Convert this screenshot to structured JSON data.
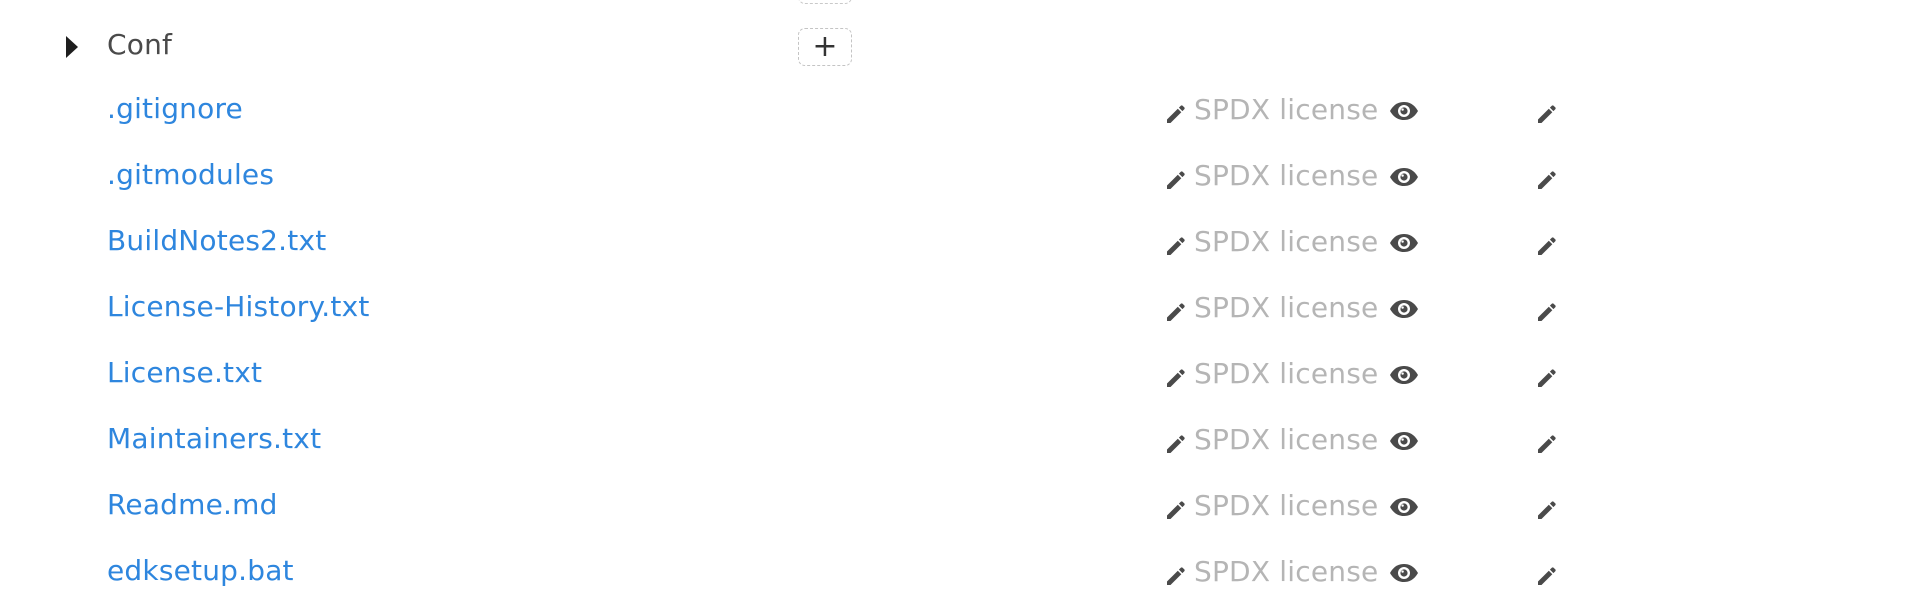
{
  "folder": {
    "name": "Conf",
    "add_label": "+"
  },
  "license_placeholder": "SPDX license",
  "icons": {
    "expand": "caret-right-icon",
    "edit": "pencil-icon",
    "view": "eye-icon"
  },
  "colors": {
    "link": "#2e86de",
    "muted": "#b5b5b5",
    "icon": "#4a4a4a"
  },
  "files": [
    {
      "name": ".gitignore",
      "license": "SPDX license"
    },
    {
      "name": ".gitmodules",
      "license": "SPDX license"
    },
    {
      "name": "BuildNotes2.txt",
      "license": "SPDX license"
    },
    {
      "name": "License-History.txt",
      "license": "SPDX license"
    },
    {
      "name": "License.txt",
      "license": "SPDX license"
    },
    {
      "name": "Maintainers.txt",
      "license": "SPDX license"
    },
    {
      "name": "Readme.md",
      "license": "SPDX license"
    },
    {
      "name": "edksetup.bat",
      "license": "SPDX license"
    }
  ]
}
